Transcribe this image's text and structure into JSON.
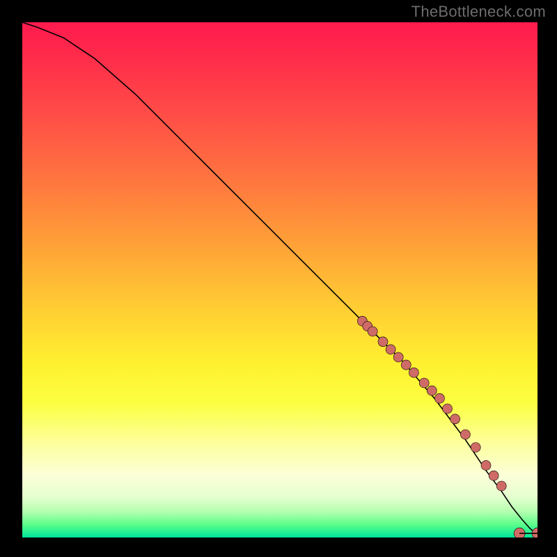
{
  "watermark": "TheBottleneck.com",
  "colors": {
    "dot_fill": "#cf6b66",
    "curve_stroke": "#000000"
  },
  "chart_data": {
    "type": "line",
    "title": "",
    "xlabel": "",
    "ylabel": "",
    "xlim": [
      0,
      100
    ],
    "ylim": [
      0,
      100
    ],
    "grid": false,
    "series": [
      {
        "name": "curve",
        "style": "line",
        "x": [
          0,
          3,
          8,
          14,
          22,
          30,
          38,
          46,
          54,
          62,
          68,
          74,
          80,
          86,
          90,
          93,
          95,
          97,
          98.5,
          100
        ],
        "y": [
          100,
          99,
          97,
          93,
          86,
          78,
          70,
          62,
          54,
          46,
          40,
          34,
          27,
          19,
          13,
          9,
          6,
          3.5,
          1.8,
          0.5
        ]
      },
      {
        "name": "points-on-curve",
        "style": "scatter",
        "marker_r": 7,
        "x": [
          66,
          67,
          68,
          70,
          71.5,
          73,
          74.5,
          76,
          78,
          79.5,
          81,
          82.5,
          84,
          86,
          88,
          90,
          91.5,
          93
        ],
        "y": [
          42,
          41,
          40,
          38,
          36.5,
          35,
          33.5,
          32,
          30,
          28.5,
          27,
          25,
          23,
          20,
          17.5,
          14,
          12,
          10
        ]
      },
      {
        "name": "bottom-points",
        "style": "scatter",
        "marker_r": 8,
        "x": [
          96.5,
          100
        ],
        "y": [
          0.8,
          0.8
        ]
      }
    ],
    "bottom_connector": {
      "x": [
        96.5,
        100
      ],
      "y": [
        0.8,
        0.8
      ]
    }
  }
}
